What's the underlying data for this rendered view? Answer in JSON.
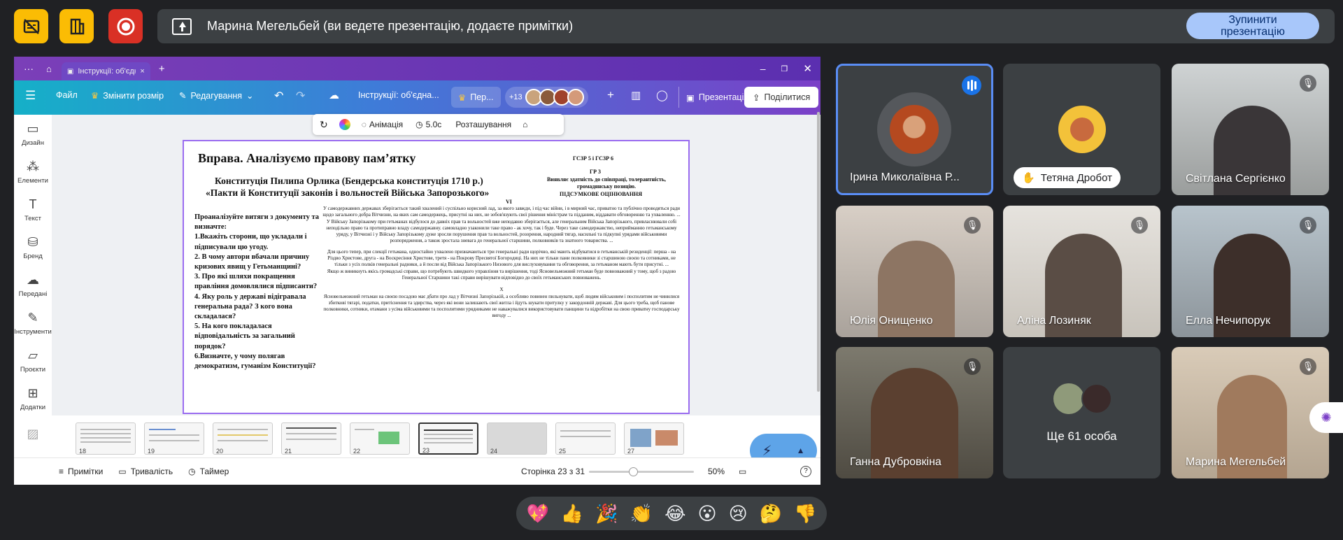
{
  "meet": {
    "banner_text": "Марина Мегельбей (ви ведете презентацію, додаєте примітки)",
    "stop_button": "Зупинити презентацію",
    "colors": {
      "top_button": "#fbbc04",
      "record_button": "#d93025",
      "stop_button": "#a8c7fa"
    },
    "tiles": [
      {
        "name": "Ірина Миколаївна Р...",
        "muted": false,
        "speaking": true,
        "avatar": "photo"
      },
      {
        "name": "Тетяна Дробот",
        "muted": false,
        "hand_raised": true,
        "avatar": "photo"
      },
      {
        "name": "Світлана Сергієнко",
        "muted": true
      },
      {
        "name": "Юлія Онищенко",
        "muted": true
      },
      {
        "name": "Аліна Лозиняк",
        "muted": true
      },
      {
        "name": "Елла Нечипорук",
        "muted": true
      },
      {
        "name": "Ганна Дубровкіна",
        "muted": true
      },
      {
        "name": "Ще 61 особа",
        "muted": false
      },
      {
        "name": "Марина Мегельбей",
        "muted": true
      }
    ],
    "reactions": [
      "💖",
      "👍",
      "🎉",
      "👏",
      "😂",
      "😮",
      "😢",
      "🤔",
      "👎"
    ]
  },
  "canva": {
    "tab_title": "Інструкції: об'єдн...",
    "toolbar": {
      "file": "Файл",
      "resize": "Змінити розмір",
      "edit": "Редагування",
      "doc_title": "Інструкції: об'єдна...",
      "per": "Пер...",
      "collab_count": "+13",
      "present": "Презентація",
      "share": "Поділитися"
    },
    "sidebar": [
      "Дизайн",
      "Елементи",
      "Текст",
      "Бренд",
      "Передані",
      "Інструменти",
      "Проєкти",
      "Додатки"
    ],
    "context": {
      "animation": "Анімація",
      "duration": "5.0с",
      "position": "Розташування"
    },
    "slide": {
      "title": "Вправа. Аналізуємо правову пам’ятку",
      "subtitle1": "Конституція Пилипа Орлика (Бендерська конституція 1710 р.)",
      "subtitle2": "«Пакти й Конституції законів і вольностей Війська Запорозького»",
      "codes": "ГСЗР 5 і ГСЗР 6",
      "gr": "ГР 3",
      "goal": "Виявляє здатність до співпраці, толерантність, громадянську позицію.",
      "assessment": "ПІДСУМКОВЕ ОЦІНЮВАННЯ",
      "tasks": [
        "Проаналізуйте витяги з документу та визначте:",
        "1.Вкажіть сторони, що укладали і підписували цю угоду.",
        "2. В чому автори вбачали причину кризових явищ у Гетьманщині?",
        "3. Про які шляхи покращення правління домовлялися підписанти?",
        "4. Яку роль у державі відігравала генеральна рада? З кого вона складалася?",
        "5. На кого покладалася відповідальність за загальний порядок?",
        "6.Визначте, у чому полягав демократизм, гуманізм Конституції?"
      ],
      "section6": "VI",
      "para1": "У самодержавних державах зберігається такий хвалений і суспільно корисний лад, за якого завжди, і під час війни, і в мирний час, приватно та публічно проводяться ради щодо загального добра Вітчизни, на яких сам самодержець, присутні на них, не зобов'язують свої рішення міністрам та підданим, віддавати обговоренню та ухваленню. ... У Війську Запорізькому при гетьманах відбулося до давніх прав та вольностей вже неподавно зберігається, але генеральним Війська Запорізького, привласнювали собі неподільно право та протиправно владу самодержавну. самовладно узаконили таке право - ак хочу, так і буде. Через таке самодержавство, неприйманню гетьманському уряду, у Вітчизні і у Війську Запорізькому дуже зросли порушення прав та вольностей, розорення, народний тягар, насильні та підкупні урядами військовими розпорядження, а також зростала зневага до генеральної старшини, полковників та знатного товариства. ...",
      "para2": "Для цього тепер, при слекції гетьмана, одностайно ухвалено призначаються три генеральні ради щорічно, які мають відбуватися в гетьманській резиденції: перша - на Різдво Христове, друга - на Воскресіння Христове, третя - на Покрову Пресвятої Богородиці. На них не тільки пани полковники зі старшиною своєю та сотниками, не тільки з усіх полків генеральні радники, а й посли від Війська Запорізького Низового для вислуховування та обговорення, за гетьманом мають бути присутні. ...",
      "para3": "Якщо ж виникнуть якісь громадські справи, що потребують швидкого управління та вирішення, тоді Ясновельможний гетьман буде повноважний у тому, щоб з радою Генеральної Старшини такі справи вирішувати відповідно до своїх гетьманських повноважень.",
      "section10": "X",
      "para4": "Ясновельможний гетьман на своєю посадою має дбати про лад у Вітчизні Запорізькій, а особливо повинен пильнувати, щоб людям військовим і посполитим не чинилися збиткові тягарі, податки, притіснення та здирства, через які вони залишають свої житла і йдуть шукати притулку у закордонній державі. Для цього треба, щоб панове полковники, сотники, отамани з усіма військовими та посполитими урядниками не наважувалися використовувати панщини та відробітки на свою приватну господарську вигоду ..."
    },
    "thumbnails": [
      "18",
      "19",
      "20",
      "21",
      "22",
      "23",
      "24",
      "25",
      "27"
    ],
    "selected_page": "23",
    "bottom": {
      "notes": "Примітки",
      "duration": "Тривалість",
      "timer": "Таймер",
      "page_info": "Сторінка 23 з 31",
      "zoom": "50%",
      "zoom_value": 0.5
    }
  }
}
